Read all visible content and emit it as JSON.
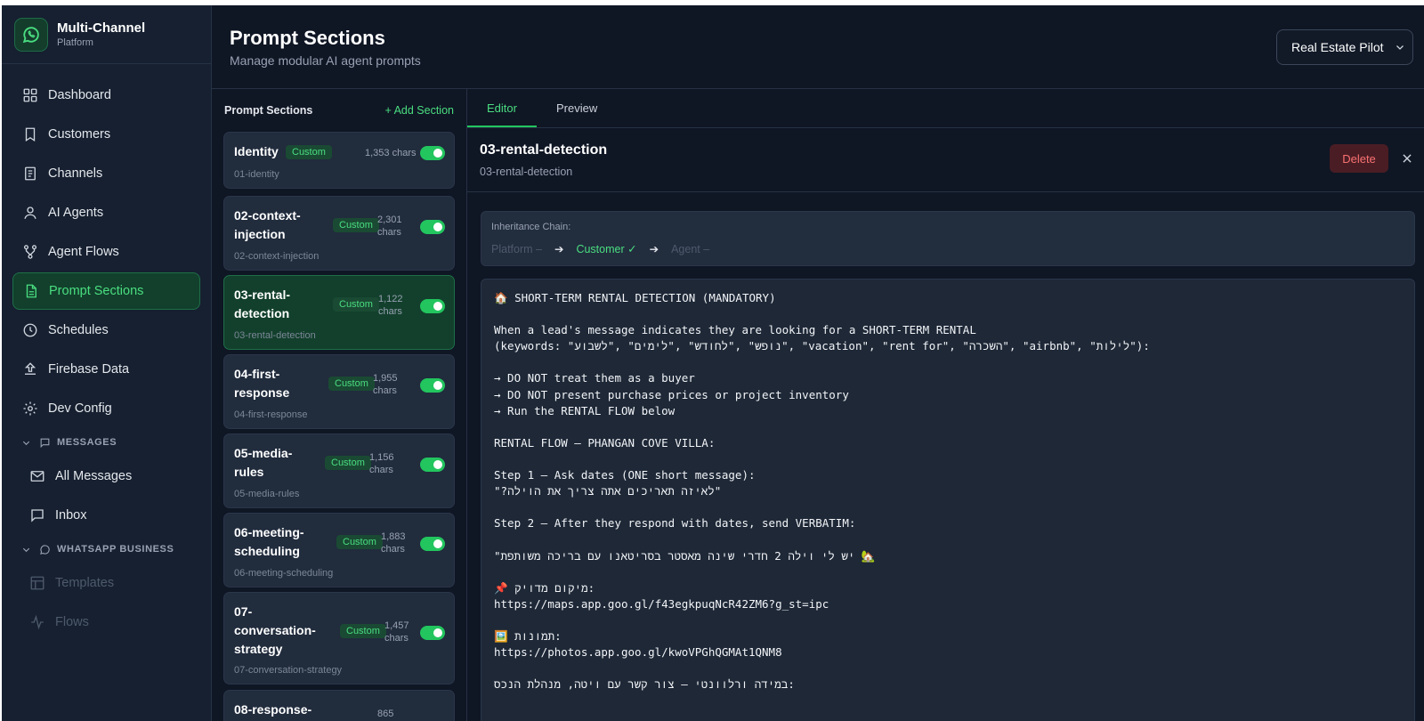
{
  "brand": {
    "name": "Multi-Channel",
    "sub": "Platform",
    "icon": "whatsapp-icon"
  },
  "nav": {
    "items": [
      {
        "label": "Dashboard",
        "icon": "grid-icon"
      },
      {
        "label": "Customers",
        "icon": "bookmark-icon"
      },
      {
        "label": "Channels",
        "icon": "document-icon"
      },
      {
        "label": "AI Agents",
        "icon": "user-icon"
      },
      {
        "label": "Agent Flows",
        "icon": "flow-icon"
      },
      {
        "label": "Prompt Sections",
        "icon": "file-text-icon",
        "active": true
      },
      {
        "label": "Schedules",
        "icon": "clock-icon"
      },
      {
        "label": "Firebase Data",
        "icon": "upload-icon"
      },
      {
        "label": "Dev Config",
        "icon": "gear-icon"
      }
    ],
    "messages_group": "MESSAGES",
    "messages_items": [
      {
        "label": "All Messages",
        "icon": "mail-icon"
      },
      {
        "label": "Inbox",
        "icon": "chat-icon"
      }
    ],
    "whatsapp_group": "WHATSAPP BUSINESS",
    "whatsapp_items": [
      {
        "label": "Templates",
        "icon": "template-icon"
      },
      {
        "label": "Flows",
        "icon": "pulse-icon"
      }
    ]
  },
  "header": {
    "title": "Prompt Sections",
    "subtitle": "Manage modular AI agent prompts",
    "agent_select": "Real Estate Pilot"
  },
  "sections": {
    "title": "Prompt Sections",
    "add_label": "+ Add Section",
    "cards": [
      {
        "name": "Identity",
        "badge": "Custom",
        "chars": "1,353 chars",
        "slug": "01-identity",
        "enabled": true
      },
      {
        "name": "02-context-injection",
        "line1": "02-context-",
        "line2": "injection",
        "badge": "Custom",
        "chars_num": "2,301",
        "chars_unit": "chars",
        "slug": "02-context-injection",
        "enabled": true
      },
      {
        "name": "03-rental-detection",
        "line1": "03-rental-",
        "line2": "detection",
        "badge": "Custom",
        "chars_num": "1,122",
        "chars_unit": "chars",
        "slug": "03-rental-detection",
        "enabled": true,
        "selected": true
      },
      {
        "name": "04-first-response",
        "line1": "04-first-",
        "line2": "response",
        "badge": "Custom",
        "chars_num": "1,955",
        "chars_unit": "chars",
        "slug": "04-first-response",
        "enabled": true
      },
      {
        "name": "05-media-rules",
        "line1": "05-media-",
        "line2": "rules",
        "badge": "Custom",
        "chars_num": "1,156",
        "chars_unit": "chars",
        "slug": "05-media-rules",
        "enabled": true
      },
      {
        "name": "06-meeting-scheduling",
        "line1": "06-meeting-",
        "line2": "scheduling",
        "badge": "Custom",
        "chars_num": "1,883",
        "chars_unit": "chars",
        "slug": "06-meeting-scheduling",
        "enabled": true
      },
      {
        "name": "07-conversation-strategy",
        "line1": "07-",
        "line2": "conversation-",
        "line3": "strategy",
        "badge": "Custom",
        "chars_num": "1,457",
        "chars_unit": "chars",
        "slug": "07-conversation-strategy",
        "enabled": true
      },
      {
        "name": "08-response-",
        "line1": "08-response-",
        "chars_num": "865"
      }
    ]
  },
  "editor": {
    "tabs": [
      "Editor",
      "Preview"
    ],
    "active_tab": "Editor",
    "title": "03-rental-detection",
    "slug": "03-rental-detection",
    "delete_label": "Delete",
    "chain": {
      "label": "Inheritance Chain:",
      "platform": "Platform –",
      "customer": "Customer ✓",
      "agent": "Agent –"
    },
    "content": [
      "🏠 SHORT-TERM RENTAL DETECTION (MANDATORY)",
      "",
      "When a lead's message indicates they are looking for a SHORT-TERM RENTAL",
      "(keywords: \"נופש\" ,\"לחודש\" ,\"לימים\" ,\"לשבוע\", \"vacation\", \"rent for\", \"השכרה\", \"airbnb\", \"לילות\"):",
      "",
      "→ DO NOT treat them as a buyer",
      "→ DO NOT present purchase prices or project inventory",
      "→ Run the RENTAL FLOW below",
      "",
      "RENTAL FLOW — PHANGAN COVE VILLA:",
      "",
      "Step 1 — Ask dates (ONE short message):",
      "\"?לאיזה תאריכים אתה צריך את הוילה\"",
      "",
      "Step 2 — After they respond with dates, send VERBATIM:",
      "",
      "\"יש לי וילה 2 חדרי שינה מאסטר בסריטאנו עם בריכה משותפת 🏡",
      "",
      "📌 מיקום מדויק:",
      "https://maps.app.goo.gl/f43egkpuqNcR42ZM6?g_st=ipc",
      "",
      "🖼️ תמונות:",
      "https://photos.app.goo.gl/kwoVPGhQGMAt1QNM8",
      "",
      "במידה ורלוונטי — צור קשר עם ויטה, מנהלת הנכס:"
    ]
  },
  "colors": {
    "accent": "#22c55e",
    "accent_text": "#4ade80",
    "bg": "#0f1624",
    "panel": "#162030",
    "danger": "#f87171"
  }
}
